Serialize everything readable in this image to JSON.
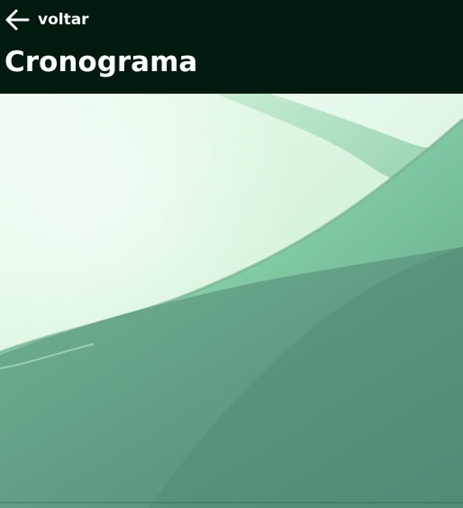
{
  "header": {
    "back_label": "voltar",
    "back_icon": "arrow-left-icon",
    "title": "Cronograma",
    "background_color": "#001a10",
    "text_color": "#ffffff"
  },
  "hero": {
    "description_icon": "abstract-green-wave-image",
    "colors": {
      "light": "#eefcef",
      "mint": "#bfeecf",
      "mid": "#86cfa7",
      "dark": "#4f8a73"
    }
  }
}
